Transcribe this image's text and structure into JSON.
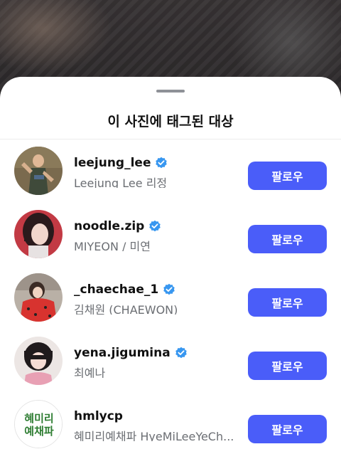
{
  "sheet": {
    "title": "이 사진에 태그된 대상"
  },
  "users": [
    {
      "username": "leejung_lee",
      "full_name": "Leejung Lee 리정",
      "verified": true,
      "follow_label": "팔로우"
    },
    {
      "username": "noodle.zip",
      "full_name": "MIYEON / 미연",
      "verified": true,
      "follow_label": "팔로우"
    },
    {
      "username": "_chaechae_1",
      "full_name": "김채원 (CHAEWON)",
      "verified": true,
      "follow_label": "팔로우"
    },
    {
      "username": "yena.jigumina",
      "full_name": "최예나",
      "verified": true,
      "follow_label": "팔로우"
    },
    {
      "username": "hmlycp",
      "full_name": "혜미리예채파 HyeMiLeeYeCh...",
      "verified": false,
      "follow_label": "팔로우",
      "avatar_text": [
        "혜미리",
        "예채파"
      ]
    }
  ],
  "colors": {
    "follow_button": "#4a5df9",
    "verified_badge": "#3897f0",
    "logo_text": "#2e7d32"
  }
}
